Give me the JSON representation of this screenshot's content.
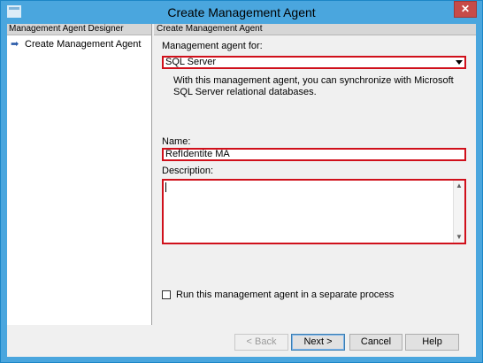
{
  "window": {
    "title": "Create Management Agent",
    "close_glyph": "✕"
  },
  "left_pane": {
    "header": "Management Agent Designer",
    "items": [
      {
        "label": "Create Management Agent",
        "icon": "arrow-right-icon",
        "current": true
      }
    ]
  },
  "main": {
    "header": "Create Management Agent",
    "agent_for": {
      "label": "Management agent for:",
      "value": "SQL Server"
    },
    "info_text": "With this management agent, you can synchronize with Microsoft SQL Server relational databases.",
    "name": {
      "label": "Name:",
      "value": "RefIdentite MA"
    },
    "description": {
      "label": "Description:",
      "value": ""
    },
    "separate_process": {
      "label": "Run this management agent in a separate process",
      "checked": false
    }
  },
  "buttons": {
    "back": "< Back",
    "next": "Next >",
    "cancel": "Cancel",
    "help": "Help"
  },
  "colors": {
    "titlebar": "#4aa6de",
    "highlight_border": "#d0101b",
    "close_button": "#c74b48"
  }
}
